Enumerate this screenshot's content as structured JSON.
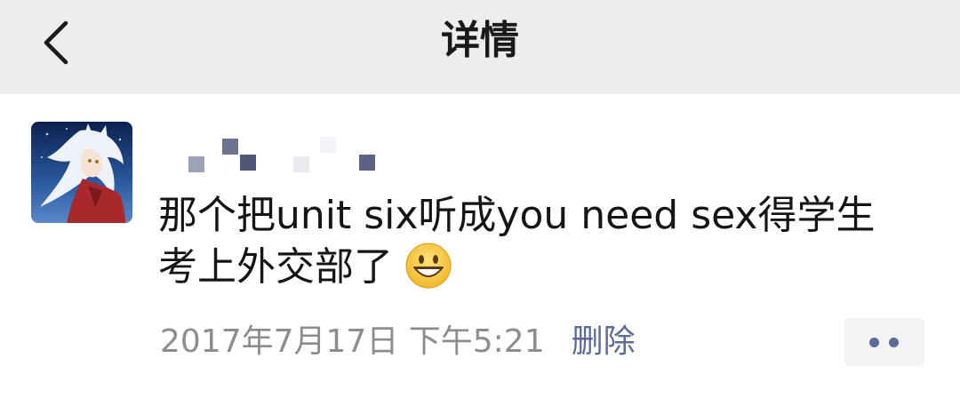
{
  "navbar": {
    "back_icon": "chevron-left-icon",
    "title": "详情"
  },
  "post": {
    "avatar_icon": "anime-avatar-icon",
    "username_redacted": true,
    "text_line1": "那个把unit six听成you need sex得学生",
    "text_line2": "考上外交部了",
    "emoji": "grinning-face-emoji",
    "timestamp": "2017年7月17日 下午5:21",
    "delete_label": "删除",
    "more_icon": "more-dots-icon"
  },
  "colors": {
    "navbar_bg": "#ededed",
    "link_blue": "#5b6b94",
    "meta_gray": "#8d8d8d",
    "text": "#151515"
  }
}
